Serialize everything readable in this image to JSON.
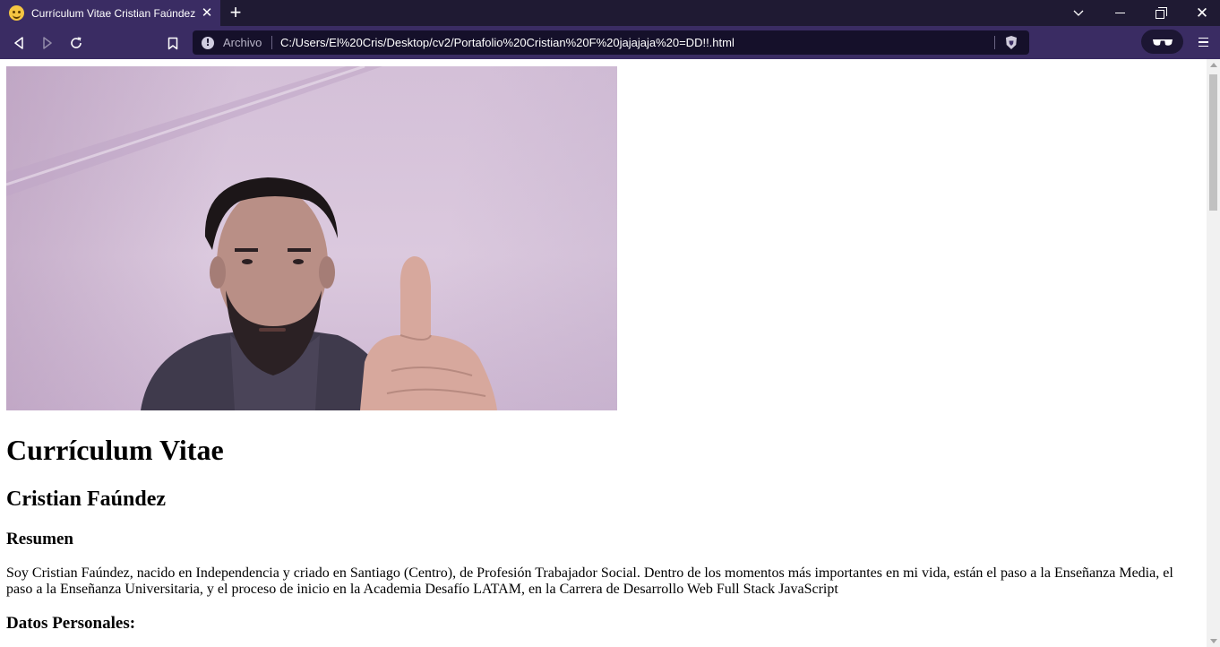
{
  "browser": {
    "tab": {
      "title": "Currículum Vitae Cristian Faúndez",
      "favicon": "smiling-face-with-halo-icon",
      "close_glyph": "✕"
    },
    "new_tab_glyph": "+",
    "window_controls": [
      "tab-search-icon",
      "minimize-icon",
      "restore-icon",
      "close-icon"
    ],
    "close_glyph": "✕",
    "address_bar": {
      "security_label": "Archivo",
      "url": "C:/Users/El%20Cris/Desktop/cv2/Portafolio%20Cristian%20F%20jajajaja%20=DD!!.html"
    },
    "colors": {
      "tab_strip": "#1f1a33",
      "toolbar": "#3a2c63",
      "omnibox": "#15102a"
    }
  },
  "page": {
    "photo_alt": "",
    "title": "Currículum Vitae",
    "name": "Cristian Faúndez",
    "summary_heading": "Resumen",
    "summary_text": "Soy Cristian Faúndez, nacido en Independencia y criado en Santiago (Centro), de Profesión Trabajador Social. Dentro de los momentos más importantes en mi vida, están el paso a la Enseñanza Media, el paso a la Enseñanza Universitaria, y el proceso de inicio en la Academia Desafío LATAM, en la Carrera de Desarrollo Web Full Stack JavaScript",
    "personal_data_heading": "Datos Personales:"
  }
}
